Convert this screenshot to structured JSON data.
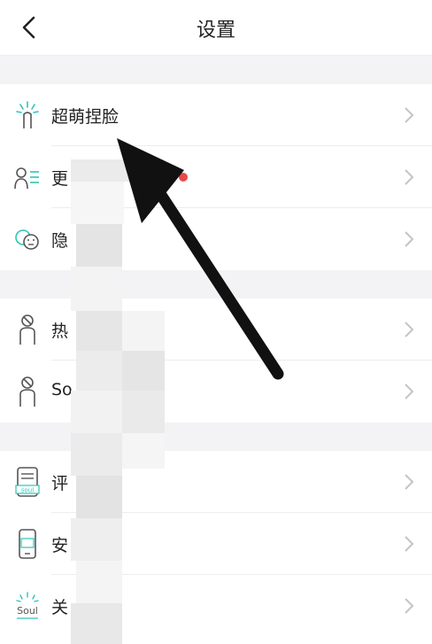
{
  "header": {
    "title": "设置"
  },
  "rows": [
    {
      "label": "超萌捏脸",
      "icon": "sparkle-figure-icon"
    },
    {
      "label": "更",
      "icon": "user-list-icon",
      "badge": "red-dot"
    },
    {
      "label": "隐",
      "icon": "faces-icon"
    },
    {
      "label": "热",
      "icon": "blocked-user-icon"
    },
    {
      "label": "So",
      "icon": "blocked-user-icon"
    },
    {
      "label": "评",
      "icon": "soul-rating-icon"
    },
    {
      "label": "安",
      "icon": "security-phone-icon"
    },
    {
      "label": "关",
      "icon": "soul-about-icon"
    }
  ],
  "colors": {
    "icon_teal": "#2ec4b6",
    "badge_red": "#e84a4a",
    "gap_bg": "#f3f3f5"
  }
}
